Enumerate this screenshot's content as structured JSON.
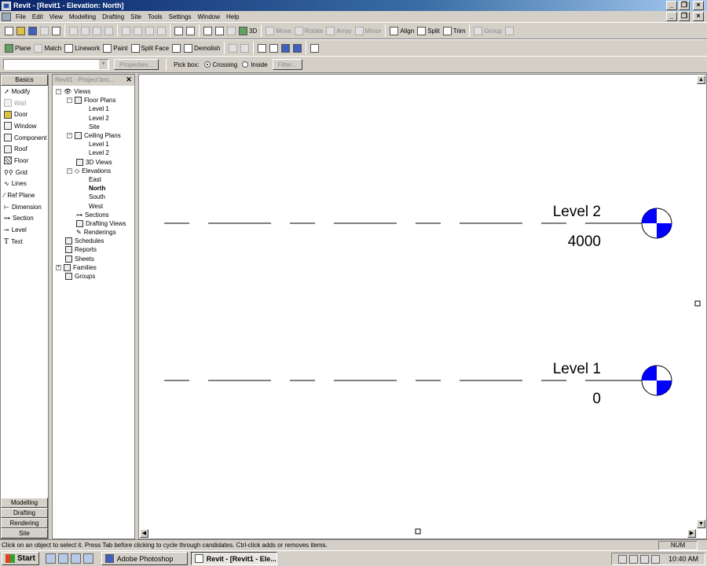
{
  "window": {
    "title": "Revit - [Revit1 - Elevation: North]"
  },
  "menu": [
    "File",
    "Edit",
    "View",
    "Modelling",
    "Drafting",
    "Site",
    "Tools",
    "Settings",
    "Window",
    "Help"
  ],
  "toolbar1": {
    "view_3d": "3D",
    "move": "Move",
    "rotate": "Rotate",
    "array": "Array",
    "mirror": "Mirror",
    "align": "Align",
    "split": "Split",
    "trim": "Trim",
    "group": "Group"
  },
  "toolbar2": {
    "plane": "Plane",
    "match": "Match",
    "linework": "Linework",
    "paint": "Paint",
    "split_face": "Split Face",
    "demolish": "Demolish"
  },
  "options": {
    "properties": "Properties...",
    "pick_box": "Pick box:",
    "crossing": "Crossing",
    "inside": "Inside",
    "filter": "Filter..."
  },
  "design_bar": {
    "tab": "Basics",
    "items": [
      "Modify",
      "Wall",
      "Door",
      "Window",
      "Component",
      "Roof",
      "Floor",
      "Grid",
      "Lines",
      "Ref Plane",
      "Dimension",
      "Section",
      "Level",
      "Text"
    ],
    "bottom_tabs": [
      "Modelling",
      "Drafting",
      "Rendering",
      "Site"
    ]
  },
  "browser": {
    "title": "Revit1 - Project bro...",
    "nodes": [
      "Views",
      "Floor Plans",
      "Level 1",
      "Level 2",
      "Site",
      "Ceiling Plans",
      "Level 1",
      "Level 2",
      "3D Views",
      "Elevations",
      "East",
      "North",
      "South",
      "West",
      "Sections",
      "Drafting Views",
      "Renderings",
      "Schedules",
      "Reports",
      "Sheets",
      "Families",
      "Groups"
    ]
  },
  "levels": [
    {
      "name": "Level 2",
      "elevation": "4000"
    },
    {
      "name": "Level 1",
      "elevation": "0"
    }
  ],
  "status": {
    "message": "Click on an object to select it. Press Tab before clicking to cycle through candidates. Ctrl-click adds or removes items.",
    "num": "NUM"
  },
  "taskbar": {
    "start": "Start",
    "tasks": [
      "Adobe Photoshop",
      "Revit - [Revit1 - Ele..."
    ],
    "time": "10:40 AM"
  }
}
